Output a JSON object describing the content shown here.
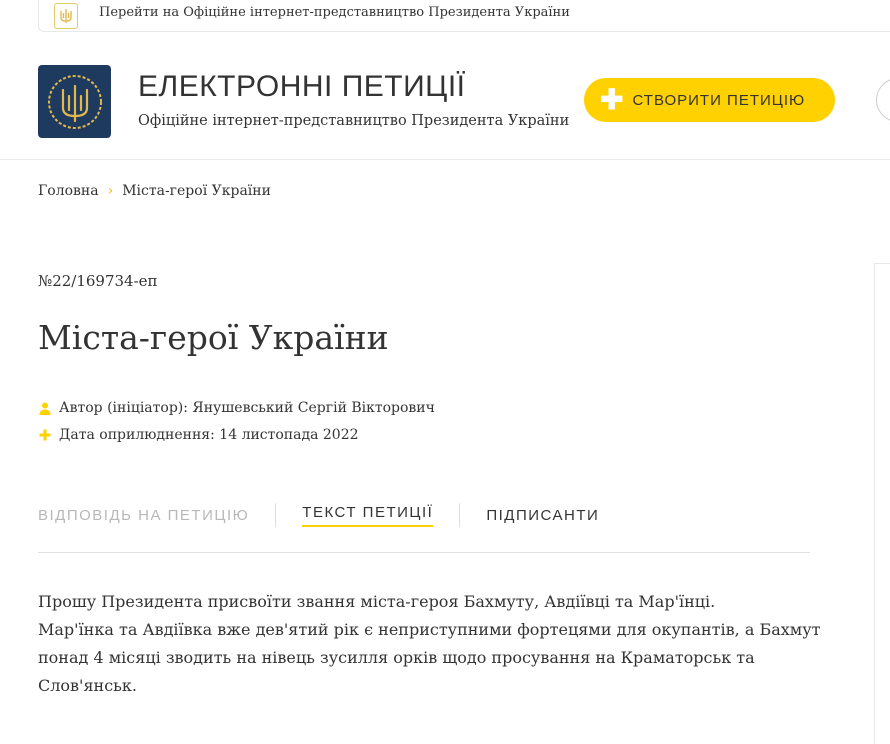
{
  "topbar": {
    "link_text": "Перейти на Офіційне інтернет-представництво Президента України"
  },
  "header": {
    "title": "ЕЛЕКТРОННІ ПЕТИЦІЇ",
    "subtitle": "Офіційне інтернет-представництво Президента України",
    "create_button": "СТВОРИТИ ПЕТИЦІЮ"
  },
  "breadcrumb": {
    "home": "Головна",
    "separator": "›",
    "current": "Міста-герої України"
  },
  "petition": {
    "number": "№22/169734-еп",
    "title": "Міста-герої України",
    "author": "Автор (ініціатор): Янушевський Сергій Вікторович",
    "date": "Дата оприлюднення: 14 листопада 2022",
    "paragraphs": [
      "Прошу Президента присвоїти звання міста-героя Бахмуту, Авдіївці та Мар'їнці.",
      "Мар'їнка та Авдіївка вже дев'ятий рік є неприступними фортецями для окупантів, а Бахмут понад 4 місяці зводить на нівець зусилля орків щодо просування на Краматорськ та Слов'янськ."
    ]
  },
  "tabs": [
    {
      "label": "ВІДПОВІДЬ НА ПЕТИЦІЮ",
      "state": "disabled"
    },
    {
      "label": "ТЕКСТ ПЕТИЦІЇ",
      "state": "active"
    },
    {
      "label": "ПІДПИСАНТИ",
      "state": "normal"
    }
  ],
  "colors": {
    "accent": "#ffd100",
    "logo_bg": "#1f3a5f",
    "logo_emblem": "#e0b84c",
    "text": "#333333",
    "muted": "#b8b8b8"
  },
  "icons": {
    "topbar_logo": "trident-icon",
    "main_logo": "trident-icon",
    "author": "user-icon",
    "date": "plus-icon"
  }
}
